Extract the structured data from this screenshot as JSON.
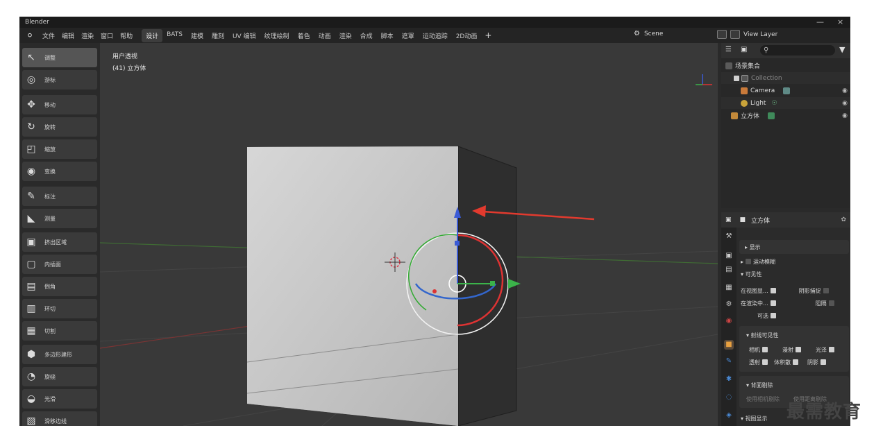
{
  "window": {
    "app_name": "Blender",
    "minimize": "—",
    "close": "×"
  },
  "menubar": {
    "menus": [
      "文件",
      "编辑",
      "渲染",
      "窗口",
      "帮助"
    ],
    "workspaces": [
      "设计",
      "BATS",
      "建模",
      "雕刻",
      "UV 编辑",
      "纹理绘制",
      "着色",
      "动画",
      "渲染",
      "合成",
      "脚本",
      "遮罩",
      "运动追踪",
      "2D动画"
    ],
    "active_workspace": "设计",
    "add_label": "+",
    "scene": "Scene",
    "view_layer": "View Layer"
  },
  "toolbar": {
    "tools": [
      {
        "label": "调整",
        "icon": "select-icon",
        "glyph": "↖"
      },
      {
        "label": "游标",
        "icon": "cursor-icon",
        "glyph": "◎"
      },
      {
        "label": "移动",
        "icon": "move-icon",
        "glyph": "✥"
      },
      {
        "label": "旋转",
        "icon": "rotate-icon",
        "glyph": "↻"
      },
      {
        "label": "缩放",
        "icon": "scale-icon",
        "glyph": "◰"
      },
      {
        "label": "变换",
        "icon": "transform-icon",
        "glyph": "◉"
      },
      {
        "label": "标注",
        "icon": "annotate-icon",
        "glyph": "✎"
      },
      {
        "label": "测量",
        "icon": "measure-icon",
        "glyph": "◣"
      },
      {
        "label": "挤出区域",
        "icon": "extrude-icon",
        "glyph": "▣"
      },
      {
        "label": "内插面",
        "icon": "inset-icon",
        "glyph": "▢"
      },
      {
        "label": "倒角",
        "icon": "bevel-icon",
        "glyph": "▤"
      },
      {
        "label": "环切",
        "icon": "loop-cut-icon",
        "glyph": "▥"
      },
      {
        "label": "切割",
        "icon": "knife-icon",
        "glyph": "▦"
      },
      {
        "label": "多边形建形",
        "icon": "poly-build-icon",
        "glyph": "⬢"
      },
      {
        "label": "旋绕",
        "icon": "spin-icon",
        "glyph": "◔"
      },
      {
        "label": "光滑",
        "icon": "smooth-icon",
        "glyph": "◒"
      },
      {
        "label": "滑移边线",
        "icon": "edge-slide-icon",
        "glyph": "▧"
      }
    ],
    "active_index": 0
  },
  "viewport": {
    "view_name": "用户透视",
    "object_label": "(41) 立方体",
    "colors": {
      "cube_face": "#cfcfcf",
      "cube_side": "#2f2f2f",
      "arrow": "#e23a2e",
      "x_axis": "#8a3a3a",
      "y_axis": "#4a7a3a"
    }
  },
  "outliner": {
    "root": "场景集合",
    "rows": [
      {
        "name": "Collection",
        "dim": true
      },
      {
        "name": "Camera",
        "dim": false
      },
      {
        "name": "Light",
        "dim": false
      },
      {
        "name": "立方体",
        "dim": false
      }
    ]
  },
  "properties": {
    "object_name": "立方体",
    "rows": {
      "display": "显示",
      "motion_blur": "运动模糊",
      "visibility": "可见性",
      "in_viewport": "在视图显...",
      "shadow_catcher": "阴影捕捉",
      "in_render": "在渲染中...",
      "holdout": "阻隔",
      "selectable": "可选",
      "ray_visibility": "射线可见性",
      "camera": "相机",
      "diffuse": "漫射",
      "glossy": "光泽",
      "transmission": "透射",
      "volume_scatter": "体积散",
      "shadow": "阴影",
      "backface_culling": "背面剔除",
      "camera_culling": "使用相机剔除",
      "distance_culling": "使用距离剔除",
      "viewport_display": "视图显示"
    }
  },
  "watermark": "最需教育"
}
